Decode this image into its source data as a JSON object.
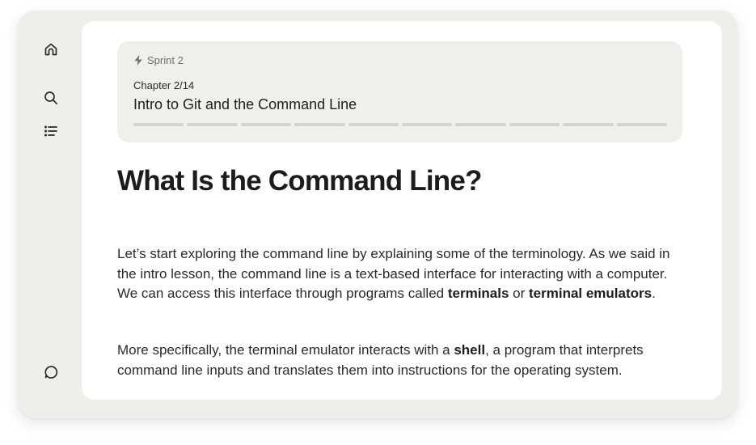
{
  "sidebar": {
    "items": [
      {
        "name": "home",
        "icon": "home-icon"
      },
      {
        "name": "search",
        "icon": "search-icon"
      },
      {
        "name": "chapters",
        "icon": "list-icon"
      },
      {
        "name": "chat",
        "icon": "chat-bubble-icon"
      }
    ]
  },
  "chapter_card": {
    "sprint_label": "Sprint 2",
    "sprint_icon": "lightning-bolt-icon",
    "chapter_count": "Chapter 2/14",
    "chapter_title": "Intro to Git and the Command Line",
    "progress": {
      "segments": 10,
      "completed": 0
    }
  },
  "article": {
    "heading": "What Is the Command Line?",
    "paragraph1": {
      "text_1": "Let’s start exploring the command line by explaining some of the terminology. As we said in the intro lesson, the command line is a text-based interface for interacting with a computer. We can access this interface through programs called ",
      "bold_1": "terminals",
      "text_2": " or ",
      "bold_2": "terminal emulators",
      "text_3": "."
    },
    "paragraph2": {
      "text_1": "More specifically, the terminal emulator interacts with a ",
      "bold_1": "shell",
      "text_2": ", a program that interprets command line inputs and translates them into instructions for the operating system."
    }
  },
  "colors": {
    "frame_bg": "#eeeeea",
    "card_bg": "#efefeb",
    "content_bg": "#ffffff",
    "text": "#1e1e1e",
    "muted": "#6e6e6a"
  }
}
